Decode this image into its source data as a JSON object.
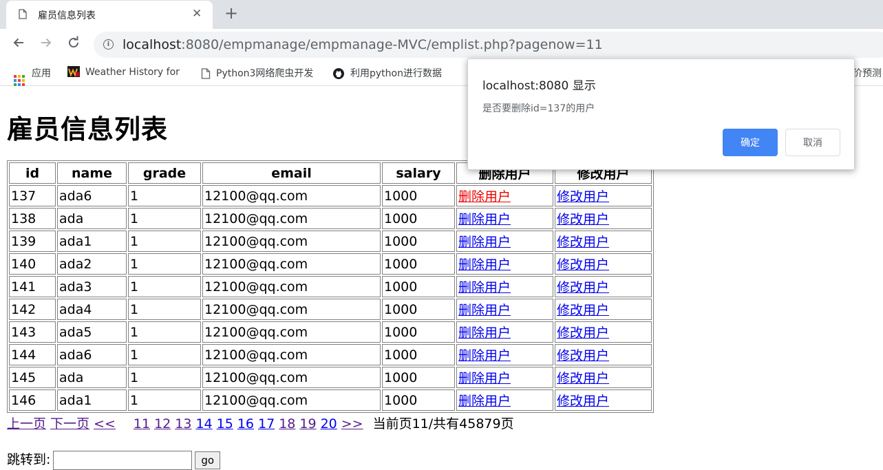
{
  "browser": {
    "tab_title": "雇员信息列表",
    "new_tab_symbol": "+",
    "url_host": "localhost",
    "url_rest": ":8080/empmanage/empmanage-MVC/emplist.php?pagenow=11",
    "bookmarks": [
      {
        "label": "应用",
        "icon": "apps-icon"
      },
      {
        "label": "Weather History for",
        "icon": "weather-icon"
      },
      {
        "label": "Python3网络爬虫开发",
        "icon": "page-icon"
      },
      {
        "label": "利用python进行数据",
        "icon": "github-icon"
      },
      {
        "label": "价预测",
        "icon": "page-icon"
      }
    ]
  },
  "page": {
    "heading": "雇员信息列表",
    "columns": [
      "id",
      "name",
      "grade",
      "email",
      "salary",
      "删除用户",
      "修改用户"
    ],
    "rows": [
      {
        "id": "137",
        "name": "ada6",
        "grade": "1",
        "email": "12100@qq.com",
        "salary": "1000",
        "del": "删除用户",
        "edit": "修改用户"
      },
      {
        "id": "138",
        "name": "ada",
        "grade": "1",
        "email": "12100@qq.com",
        "salary": "1000",
        "del": "删除用户",
        "edit": "修改用户"
      },
      {
        "id": "139",
        "name": "ada1",
        "grade": "1",
        "email": "12100@qq.com",
        "salary": "1000",
        "del": "删除用户",
        "edit": "修改用户"
      },
      {
        "id": "140",
        "name": "ada2",
        "grade": "1",
        "email": "12100@qq.com",
        "salary": "1000",
        "del": "删除用户",
        "edit": "修改用户"
      },
      {
        "id": "141",
        "name": "ada3",
        "grade": "1",
        "email": "12100@qq.com",
        "salary": "1000",
        "del": "删除用户",
        "edit": "修改用户"
      },
      {
        "id": "142",
        "name": "ada4",
        "grade": "1",
        "email": "12100@qq.com",
        "salary": "1000",
        "del": "删除用户",
        "edit": "修改用户"
      },
      {
        "id": "143",
        "name": "ada5",
        "grade": "1",
        "email": "12100@qq.com",
        "salary": "1000",
        "del": "删除用户",
        "edit": "修改用户"
      },
      {
        "id": "144",
        "name": "ada6",
        "grade": "1",
        "email": "12100@qq.com",
        "salary": "1000",
        "del": "删除用户",
        "edit": "修改用户"
      },
      {
        "id": "145",
        "name": "ada",
        "grade": "1",
        "email": "12100@qq.com",
        "salary": "1000",
        "del": "删除用户",
        "edit": "修改用户"
      },
      {
        "id": "146",
        "name": "ada1",
        "grade": "1",
        "email": "12100@qq.com",
        "salary": "1000",
        "del": "删除用户",
        "edit": "修改用户"
      }
    ],
    "pager": {
      "prev": "上一页",
      "next": "下一页",
      "back": "<<",
      "pages": [
        "11",
        "12",
        "13",
        "14",
        "15",
        "16",
        "17",
        "18",
        "19",
        "20"
      ],
      "forward": ">>",
      "status": "当前页11/共有45879页"
    },
    "jump": {
      "label": "跳转到:",
      "value": "",
      "button": "go"
    }
  },
  "dialog": {
    "title": "localhost:8080 显示",
    "message": "是否要删除id=137的用户",
    "ok": "确定",
    "cancel": "取消",
    "ok_color": "#4285f4"
  }
}
